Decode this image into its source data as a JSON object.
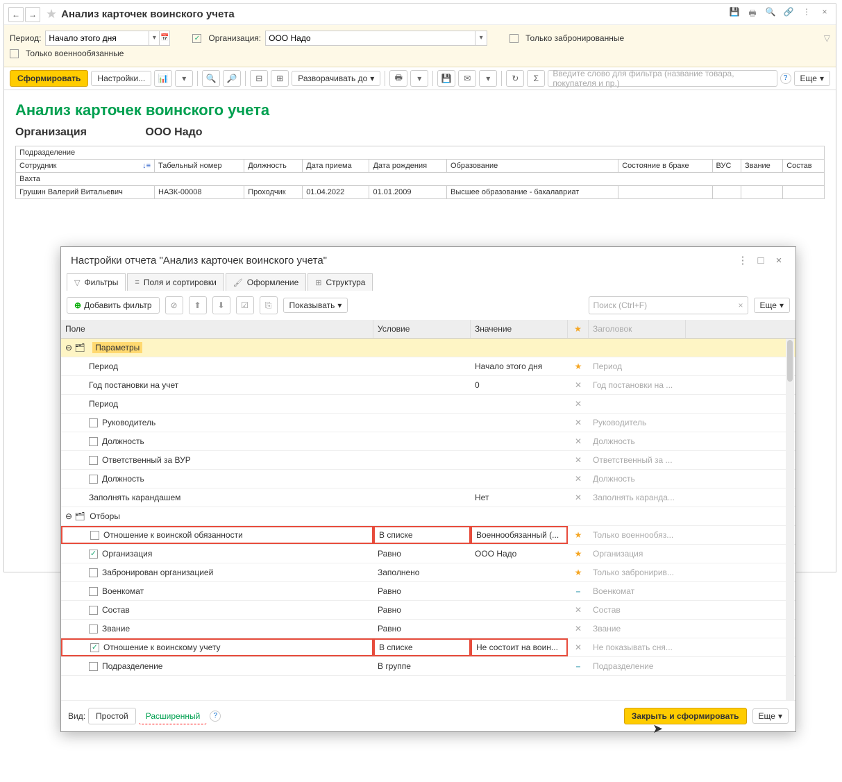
{
  "title": "Анализ карточек воинского учета",
  "period_label": "Период:",
  "period_value": "Начало этого дня",
  "org_label": "Организация:",
  "org_value": "ООО Надо",
  "only_booked": "Только забронированные",
  "only_military": "Только военнообязанные",
  "btn_generate": "Сформировать",
  "btn_settings": "Настройки...",
  "btn_expand": "Разворачивать до",
  "btn_more": "Еще",
  "search_placeholder": "Введите слово для фильтра (название товара, покупателя и пр.)",
  "report_title": "Анализ карточек воинского учета",
  "report_org_label": "Организация",
  "report_org_value": "ООО Надо",
  "dept_label": "Подразделение",
  "columns": {
    "emp": "Сотрудник",
    "num": "Табельный номер",
    "pos": "Должность",
    "hire": "Дата приема",
    "birth": "Дата рождения",
    "edu": "Образование",
    "mar": "Состояние в браке",
    "vus": "ВУС",
    "rank": "Звание",
    "staff": "Состав"
  },
  "row": {
    "group": "Вахта",
    "name": "Грушин Валерий Витальевич",
    "num": "НАЗК-00008",
    "pos": "Проходчик",
    "hire": "01.04.2022",
    "birth": "01.01.2009",
    "edu": "Высшее образование - бакалавриат"
  },
  "modal": {
    "title": "Настройки отчета \"Анализ карточек воинского учета\"",
    "tabs": {
      "filters": "Фильтры",
      "fields": "Поля и сортировки",
      "design": "Оформление",
      "struct": "Структура"
    },
    "btn_addfilter": "Добавить фильтр",
    "btn_show": "Показывать",
    "search_placeholder": "Поиск (Ctrl+F)",
    "cols": {
      "field": "Поле",
      "cond": "Условие",
      "val": "Значение",
      "head": "Заголовок"
    },
    "params": "Параметры",
    "selections": "Отборы",
    "rows": [
      {
        "f": "Период",
        "v": "Начало этого дня",
        "i": "star",
        "h": "Период"
      },
      {
        "f": "Год постановки на учет",
        "v": "0",
        "i": "x",
        "h": "Год постановки на ..."
      },
      {
        "f": "Период",
        "i": "x",
        "h": ""
      },
      {
        "f": "Руководитель",
        "i": "x",
        "h": "Руководитель",
        "chk": false
      },
      {
        "f": "Должность",
        "i": "x",
        "h": "Должность",
        "chk": false
      },
      {
        "f": "Ответственный за ВУР",
        "i": "x",
        "h": "Ответственный за ...",
        "chk": false
      },
      {
        "f": "Должность",
        "i": "x",
        "h": "Должность",
        "chk": false
      },
      {
        "f": "Заполнять карандашем",
        "v": "Нет",
        "i": "x",
        "h": "Заполнять каранда..."
      }
    ],
    "selrows": [
      {
        "f": "Отношение к воинской обязанности",
        "c": "В списке",
        "v": "Военнообязанный (...",
        "i": "starplus",
        "h": "Только военнообяз...",
        "chk": false,
        "red": true
      },
      {
        "f": "Организация",
        "c": "Равно",
        "v": "ООО Надо",
        "i": "star",
        "h": "Организация",
        "chk": true
      },
      {
        "f": "Забронирован организацией",
        "c": "Заполнено",
        "i": "starplus",
        "h": "Только забронирив...",
        "chk": false
      },
      {
        "f": "Военкомат",
        "c": "Равно",
        "i": "dash",
        "h": "Военкомат",
        "chk": false
      },
      {
        "f": "Состав",
        "c": "Равно",
        "i": "x",
        "h": "Состав",
        "chk": false
      },
      {
        "f": "Звание",
        "c": "Равно",
        "i": "x",
        "h": "Звание",
        "chk": false
      },
      {
        "f": "Отношение к воинскому учету",
        "c": "В списке",
        "v": "Не состоит на воин...",
        "i": "x",
        "h": "Не показывать сня...",
        "chk": true,
        "red": true
      },
      {
        "f": "Подразделение",
        "c": "В группе",
        "i": "dash",
        "h": "Подразделение",
        "chk": false
      }
    ],
    "footer": {
      "view": "Вид:",
      "simple": "Простой",
      "advanced": "Расширенный",
      "close": "Закрыть и сформировать",
      "more": "Еще"
    }
  }
}
